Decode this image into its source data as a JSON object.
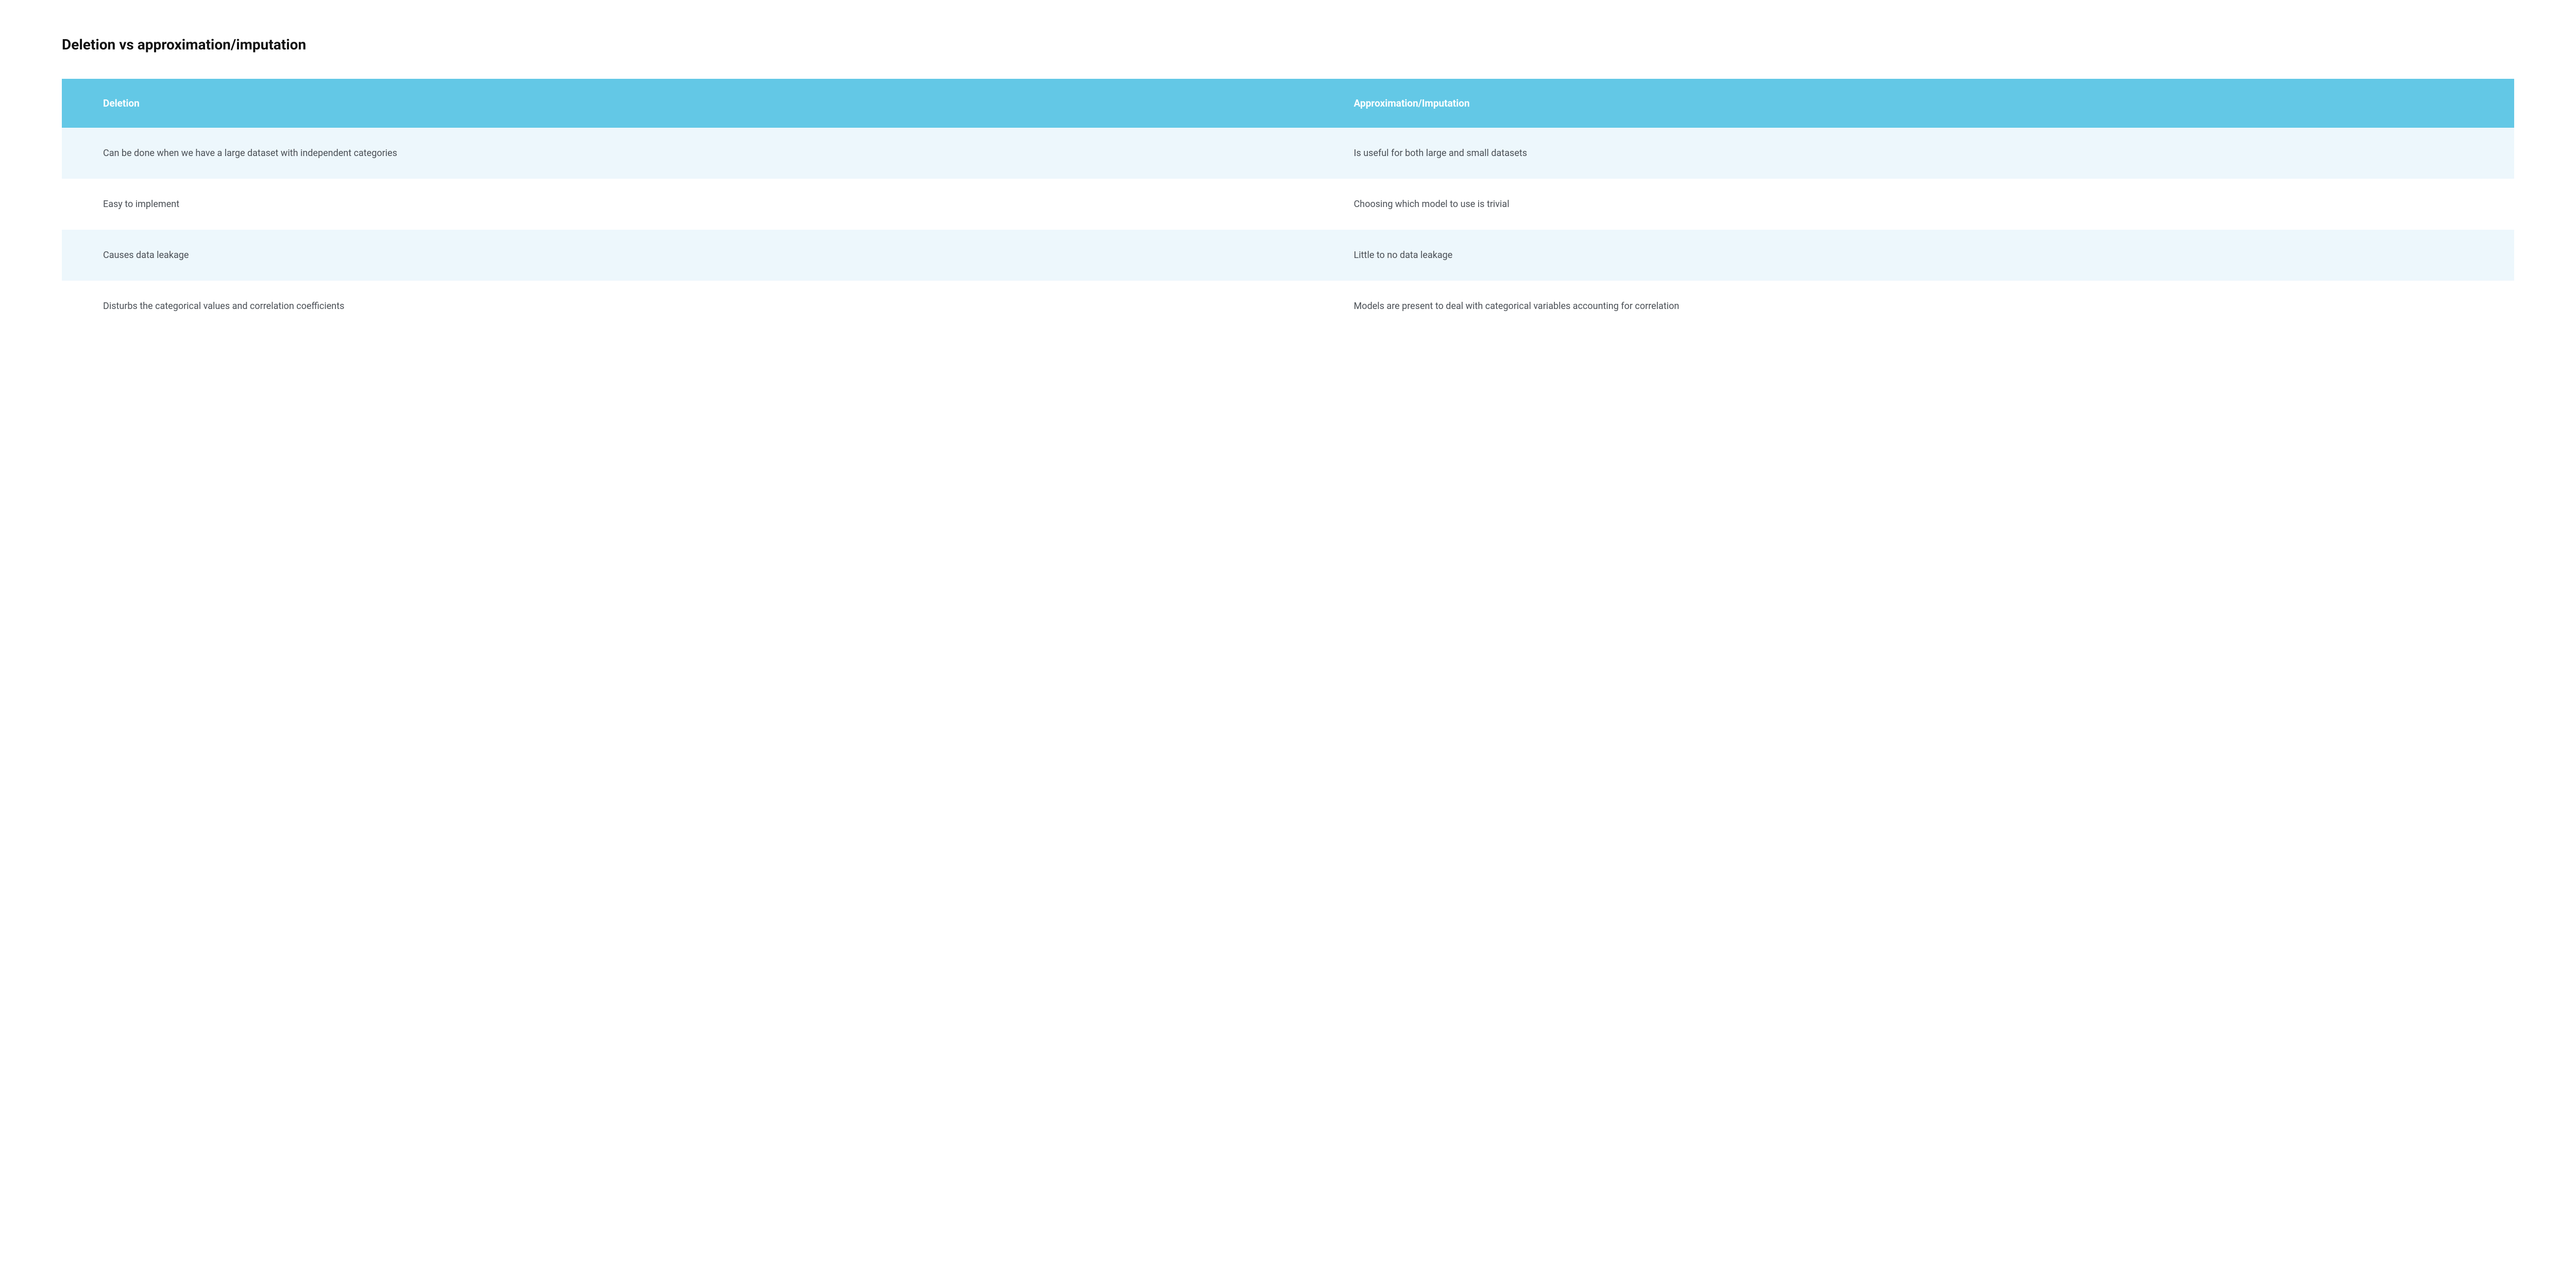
{
  "title": "Deletion vs approximation/imputation",
  "headers": {
    "left": "Deletion",
    "right": "Approximation/Imputation"
  },
  "rows": [
    {
      "left": "Can be done when we have a large dataset with independent categories",
      "right": "Is useful for both large and small datasets"
    },
    {
      "left": "Easy to implement",
      "right": "Choosing which model to use is trivial"
    },
    {
      "left": "Causes data leakage",
      "right": "Little to no data leakage"
    },
    {
      "left": "Disturbs the categorical values and correlation coefficients",
      "right": "Models are present to deal with categorical variables accounting for correlation"
    }
  ]
}
